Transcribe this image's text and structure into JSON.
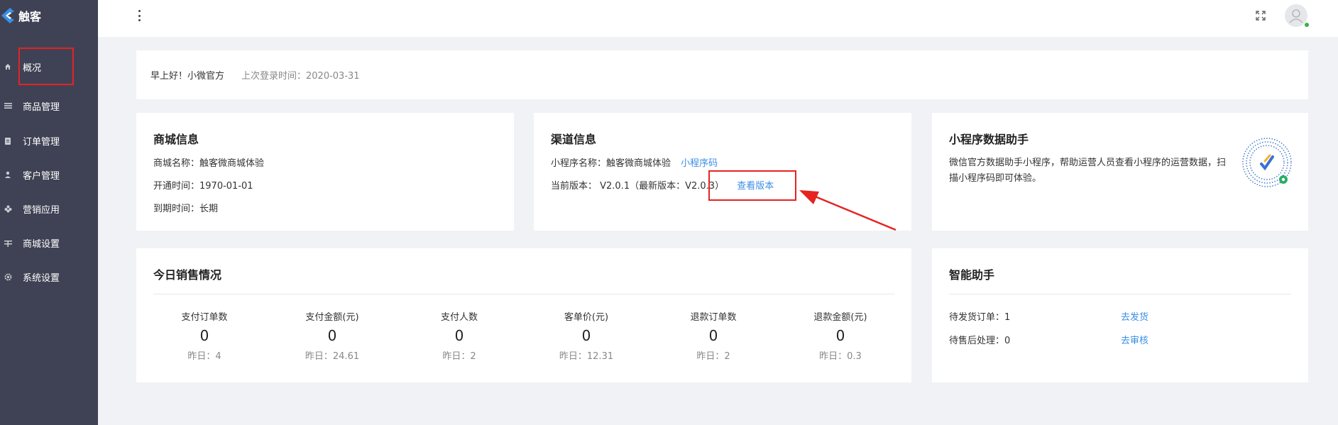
{
  "brand": {
    "name": "触客",
    "color": "#3a8ee6"
  },
  "sidebar": {
    "items": [
      {
        "label": "概况",
        "icon": "home-icon"
      },
      {
        "label": "商品管理",
        "icon": "list-icon"
      },
      {
        "label": "订单管理",
        "icon": "clipboard-icon"
      },
      {
        "label": "客户管理",
        "icon": "user-icon"
      },
      {
        "label": "营销应用",
        "icon": "puzzle-icon"
      },
      {
        "label": "商城设置",
        "icon": "settings-sliders-icon"
      },
      {
        "label": "系统设置",
        "icon": "gear-icon"
      }
    ],
    "active_index": 0
  },
  "welcome": {
    "greeting": "早上好！小微官方",
    "last_login": "上次登录时间：2020-03-31"
  },
  "store_info": {
    "title": "商城信息",
    "name": "商城名称：触客微商城体验",
    "open_time": "开通时间：1970-01-01",
    "expire": "到期时间：长期"
  },
  "channel_info": {
    "title": "渠道信息",
    "miniapp_name": "小程序名称：触客微商城体验",
    "miniapp_code_link": "小程序码",
    "version": "当前版本： V2.0.1（最新版本：V2.0.3）",
    "view_version_link": "查看版本"
  },
  "data_helper": {
    "title": "小程序数据助手",
    "description": "微信官方数据助手小程序，帮助运营人员查看小程序的运营数据，扫描小程序码即可体验。"
  },
  "sales_today": {
    "title": "今日销售情况",
    "stats": [
      {
        "label": "支付订单数",
        "value": "0",
        "yesterday": "昨日：4"
      },
      {
        "label": "支付金额(元)",
        "value": "0",
        "yesterday": "昨日：24.61"
      },
      {
        "label": "支付人数",
        "value": "0",
        "yesterday": "昨日：2"
      },
      {
        "label": "客单价(元)",
        "value": "0",
        "yesterday": "昨日：12.31"
      },
      {
        "label": "退款订单数",
        "value": "0",
        "yesterday": "昨日：2"
      },
      {
        "label": "退款金额(元)",
        "value": "0",
        "yesterday": "昨日：0.3"
      }
    ]
  },
  "assistant": {
    "title": "智能助手",
    "tasks": [
      {
        "label": "待发货订单：1",
        "action": "去发货"
      },
      {
        "label": "待售后处理：0",
        "action": "去审核"
      }
    ]
  },
  "annotation_color": "#e52323"
}
